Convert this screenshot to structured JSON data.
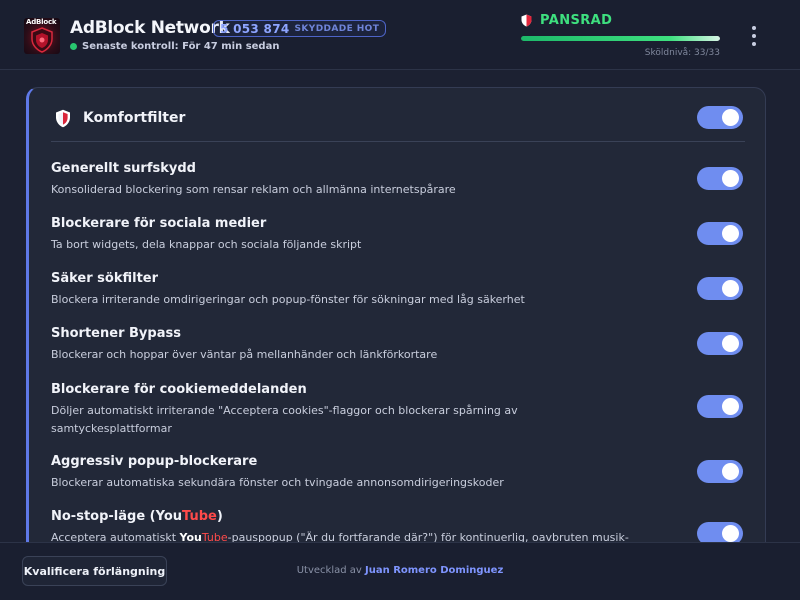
{
  "header": {
    "logo_text": "AdBlock",
    "app_title": "AdBlock Network",
    "blocked_count": "5 053 874",
    "blocked_label": "SKYDDADE HOT",
    "last_check": "Senaste kontroll: För 47 min sedan",
    "status_label": "PANSRAD",
    "shield_level_text": "Sköldnivå: 33/33",
    "shield_level_fraction": 1.0,
    "menu_icon": "kebab-menu-icon"
  },
  "card": {
    "title": "Komfortfilter",
    "icon": "shield-icon",
    "enabled": true,
    "items": [
      {
        "title": "Generellt surfskydd",
        "desc": "Konsoliderad blockering som rensar reklam och allmänna internetspårare",
        "enabled": true
      },
      {
        "title": "Blockerare för sociala medier",
        "desc": "Ta bort widgets, dela knappar och sociala följande skript",
        "enabled": true
      },
      {
        "title": "Säker sökfilter",
        "desc": "Blockera irriterande omdirigeringar och popup-fönster för sökningar med låg säkerhet",
        "enabled": true
      },
      {
        "title": "Shortener Bypass",
        "desc": "Blockerar och hoppar över väntar på mellanhänder och länkförkortare",
        "enabled": true
      },
      {
        "title": "Blockerare för cookiemeddelanden",
        "desc": "Döljer automatiskt irriterande \"Acceptera cookies\"-flaggor och blockerar spårning av samtyckesplattformar",
        "enabled": true
      },
      {
        "title": "Aggressiv popup-blockerare",
        "desc": "Blockerar automatiska sekundära fönster och tvingade annonsomdirigeringskoder",
        "enabled": true
      },
      {
        "title_prefix": "No-stop-läge (You",
        "title_brand": "Tube",
        "title_suffix": ")",
        "desc_prefix": "Acceptera automatiskt ",
        "desc_brand_you": "You",
        "desc_brand_tube": "Tube",
        "desc_suffix": "-pauspopup (\"Är du fortfarande där?\") för kontinuerlig, oavbruten musik-",
        "enabled": true
      }
    ]
  },
  "footer": {
    "extension_button": "Kvalificera förlängning",
    "developer_prefix": "Utvecklad av",
    "developer_name": "Juan Romero Dominguez"
  },
  "colors": {
    "accent": "#6f8df0",
    "status_green": "#3ee07f",
    "brand_red": "#ff4a4a"
  }
}
